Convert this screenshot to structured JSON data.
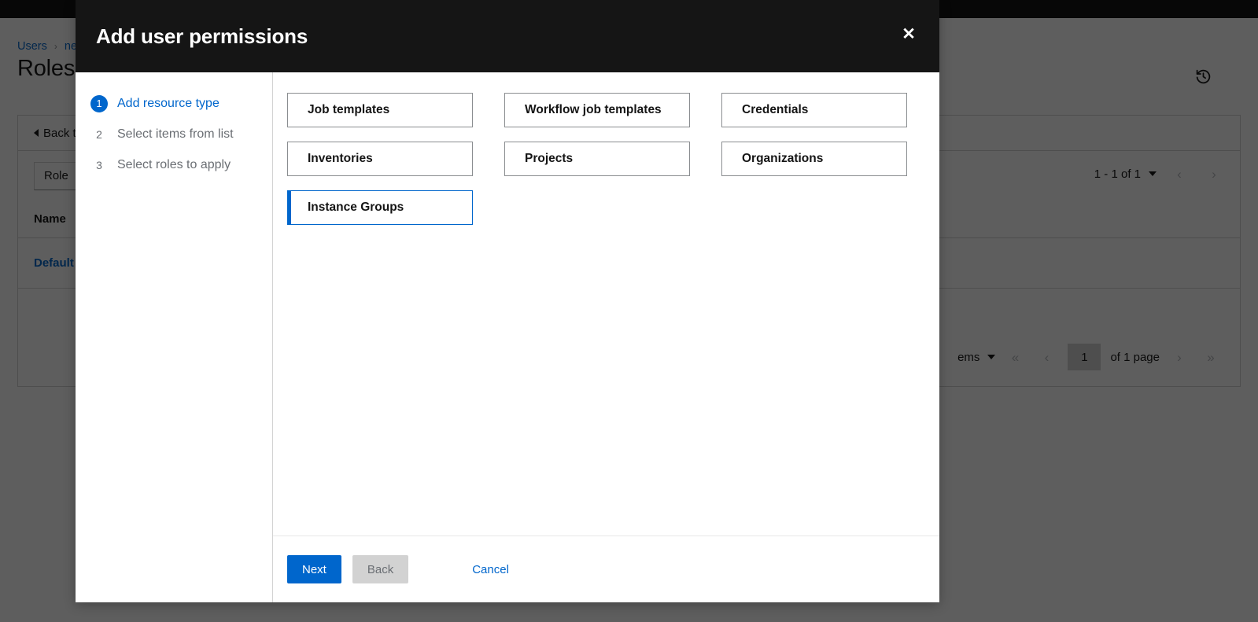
{
  "background": {
    "breadcrumb": {
      "root": "Users",
      "separator": "›",
      "current": "ne"
    },
    "page_title": "Roles",
    "history_icon": "history-icon",
    "back_button": "Back t",
    "role_filter": {
      "label": "Role",
      "caret": "chevron-down-icon"
    },
    "pagination_top": {
      "range": "1 - 1 of 1",
      "caret": "chevron-down-icon",
      "prev": "‹",
      "next": "›"
    },
    "table": {
      "columns": [
        "Name"
      ],
      "rows": [
        [
          "Default"
        ]
      ]
    },
    "pagination_bottom": {
      "per_page": "ems",
      "caret": "chevron-down-icon",
      "first": "«",
      "prev": "‹",
      "page_value": "1",
      "of_pages": "of 1 page",
      "next": "›",
      "last": "»"
    }
  },
  "modal": {
    "title": "Add user permissions",
    "close_label": "✕",
    "steps": [
      {
        "num": "1",
        "label": "Add resource type",
        "active": true
      },
      {
        "num": "2",
        "label": "Select items from list",
        "active": false
      },
      {
        "num": "3",
        "label": "Select roles to apply",
        "active": false
      }
    ],
    "resource_types": [
      {
        "label": "Job templates",
        "selected": false
      },
      {
        "label": "Workflow job templates",
        "selected": false
      },
      {
        "label": "Credentials",
        "selected": false
      },
      {
        "label": "Inventories",
        "selected": false
      },
      {
        "label": "Projects",
        "selected": false
      },
      {
        "label": "Organizations",
        "selected": false
      },
      {
        "label": "Instance Groups",
        "selected": true
      }
    ],
    "footer": {
      "next": "Next",
      "back": "Back",
      "cancel": "Cancel"
    }
  },
  "colors": {
    "accent_blue": "#0066cc",
    "header_dark": "#151515",
    "border_gray": "#d2d2d2",
    "disabled_gray": "#d2d2d2"
  }
}
